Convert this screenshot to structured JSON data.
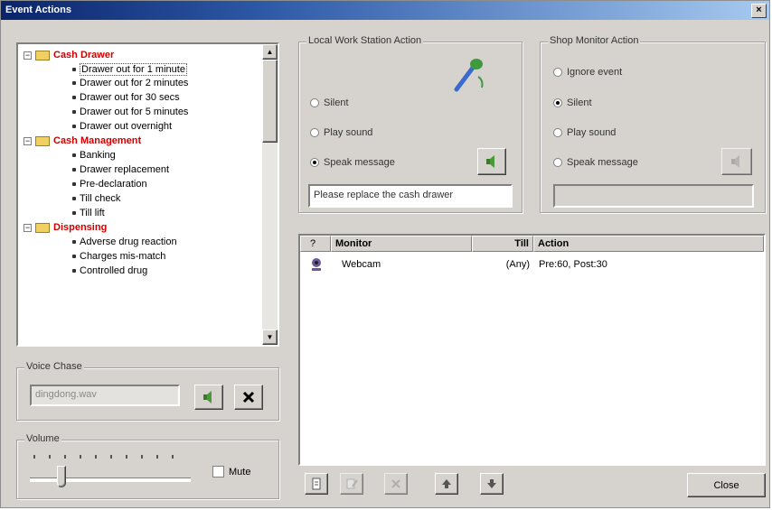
{
  "window": {
    "title": "Event Actions",
    "close_glyph": "×"
  },
  "tree": {
    "categories": [
      {
        "label": "Cash Drawer",
        "items": [
          "Drawer out for 1 minute",
          "Drawer out for 2 minutes",
          "Drawer out for 30 secs",
          "Drawer out for 5 minutes",
          "Drawer out overnight"
        ]
      },
      {
        "label": "Cash Management",
        "items": [
          "Banking",
          "Drawer replacement",
          "Pre-declaration",
          "Till check",
          "Till lift"
        ]
      },
      {
        "label": "Dispensing",
        "items": [
          "Adverse drug reaction",
          "Charges mis-match",
          "Controlled drug"
        ]
      }
    ],
    "selected": "Drawer out for 1 minute"
  },
  "local_action": {
    "title": "Local Work Station Action",
    "options": [
      "Silent",
      "Play sound",
      "Speak message"
    ],
    "selected": "Speak message",
    "message": "Please replace the cash drawer"
  },
  "shop_action": {
    "title": "Shop Monitor Action",
    "options": [
      "Ignore event",
      "Silent",
      "Play sound",
      "Speak message"
    ],
    "selected": "Silent",
    "message": ""
  },
  "monitor_table": {
    "columns": [
      "?",
      "Monitor",
      "Till",
      "Action"
    ],
    "rows": [
      {
        "monitor": "Webcam",
        "till": "(Any)",
        "action": "Pre:60, Post:30"
      }
    ]
  },
  "voice": {
    "title": "Voice Chase",
    "file": "dingdong.wav"
  },
  "volume": {
    "title": "Volume",
    "mute_label": "Mute",
    "mute_checked": false
  },
  "close_button": "Close"
}
